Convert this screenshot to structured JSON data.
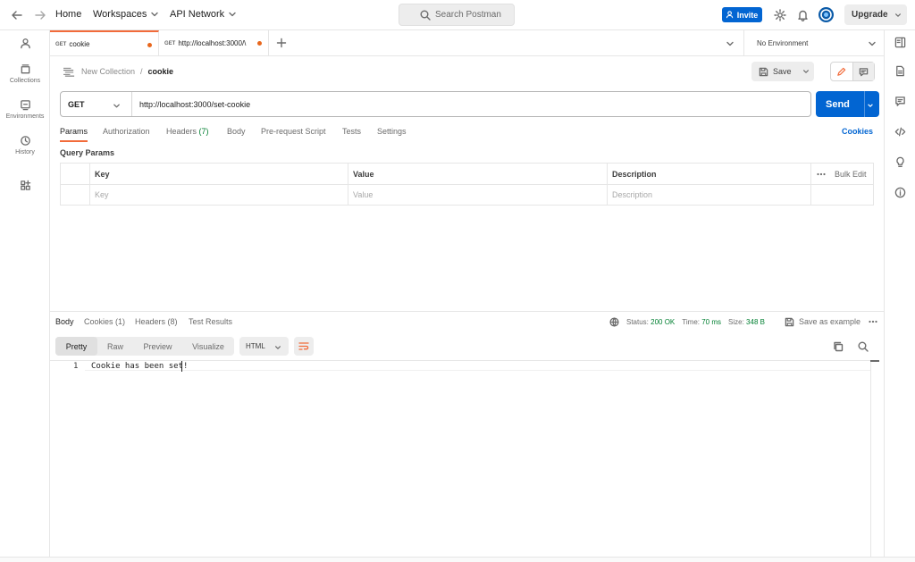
{
  "topbar": {
    "home": "Home",
    "workspaces": "Workspaces",
    "api_network": "API Network",
    "search_placeholder": "Search Postman",
    "invite": "Invite",
    "upgrade": "Upgrade"
  },
  "sidebar": {
    "items": [
      {
        "label": "",
        "icon": "user-icon"
      },
      {
        "label": "Collections",
        "icon": "collections-icon"
      },
      {
        "label": "Environments",
        "icon": "environments-icon"
      },
      {
        "label": "History",
        "icon": "history-icon"
      },
      {
        "label": "",
        "icon": "apps-icon"
      }
    ]
  },
  "tabs": [
    {
      "method": "GET",
      "title": "cookie",
      "unsaved": true
    },
    {
      "method": "GET",
      "title": "http://localhost:3000/\\",
      "unsaved": true
    }
  ],
  "environment": "No Environment",
  "breadcrumb": {
    "collection": "New Collection",
    "separator": "/",
    "request": "cookie"
  },
  "save_label": "Save",
  "request": {
    "method": "GET",
    "url": "http://localhost:3000/set-cookie",
    "send_label": "Send"
  },
  "request_tabs": {
    "params": "Params",
    "authorization": "Authorization",
    "headers": "Headers",
    "headers_count": "(7)",
    "body": "Body",
    "pre_request": "Pre-request Script",
    "tests": "Tests",
    "settings": "Settings",
    "cookies": "Cookies"
  },
  "query_params": {
    "title": "Query Params",
    "headers": {
      "key": "Key",
      "value": "Value",
      "description": "Description",
      "bulk_edit": "Bulk Edit"
    },
    "placeholders": {
      "key": "Key",
      "value": "Value",
      "description": "Description"
    }
  },
  "response": {
    "tabs": {
      "body": "Body",
      "cookies": "Cookies",
      "cookies_count": "(1)",
      "headers": "Headers",
      "headers_count": "(8)",
      "test_results": "Test Results"
    },
    "status_label": "Status:",
    "status_value": "200 OK",
    "time_label": "Time:",
    "time_value": "70 ms",
    "size_label": "Size:",
    "size_value": "348 B",
    "save_as_example": "Save as example",
    "views": {
      "pretty": "Pretty",
      "raw": "Raw",
      "preview": "Preview",
      "visualize": "Visualize"
    },
    "format": "HTML",
    "lines": [
      {
        "n": "1",
        "text": "Cookie has been set!"
      }
    ]
  },
  "colors": {
    "accent": "#f26b3a",
    "primary": "#0265d2",
    "success": "#007f31",
    "unsaved_dot": "#e8671d"
  }
}
